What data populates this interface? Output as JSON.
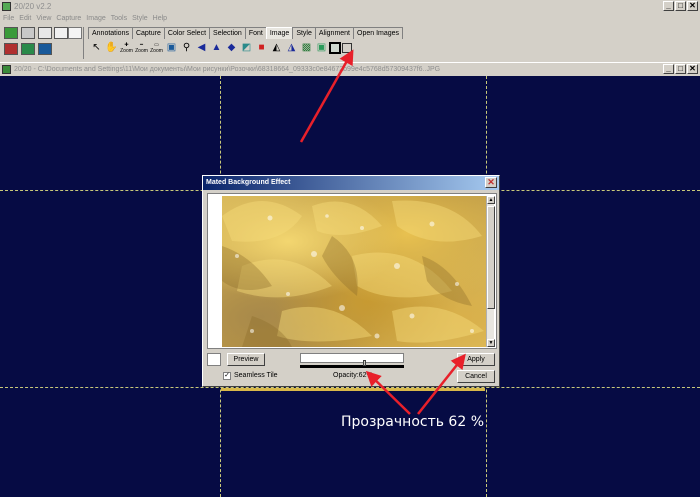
{
  "app": {
    "title": "20/20 v2.2",
    "menu": [
      "File",
      "Edit",
      "View",
      "Capture",
      "Image",
      "Tools",
      "Style",
      "Help"
    ],
    "window_buttons": [
      "_",
      "□",
      "✕"
    ]
  },
  "toolbar": {
    "tabs": [
      {
        "label": "Annotations",
        "active": false
      },
      {
        "label": "Capture",
        "active": false
      },
      {
        "label": "Color Select",
        "active": false
      },
      {
        "label": "Selection",
        "active": false
      },
      {
        "label": "Font",
        "active": false
      },
      {
        "label": "Image",
        "active": true
      },
      {
        "label": "Style",
        "active": false
      },
      {
        "label": "Alignment",
        "active": false
      },
      {
        "label": "Open Images",
        "active": false
      }
    ],
    "zoom_labels": [
      "Zoom",
      "Zoom",
      "Zoom"
    ]
  },
  "document": {
    "title": "20/20 - C:\\Documents and Settings\\11\\Мои документы\\Мои рисунки\\Розочки\\68318664_09333c0e84672b99e4c5768d57309437f6..JPG"
  },
  "dialog": {
    "title": "Mated Background Effect",
    "close": "✕",
    "preview_button": "Preview",
    "apply_button": "Apply",
    "cancel_button": "Cancel",
    "seamless_tile_label": "Seamless Tile",
    "seamless_tile_checked": true,
    "check_mark": "✓",
    "opacity_label": "Opacity:62%",
    "opacity_value": 0.62
  },
  "annotation": {
    "text": "Прозрачность 62 %",
    "color": "#ffffff",
    "arrow_color": "#e8202a"
  },
  "colors": {
    "canvas": "#060b44",
    "chrome": "#d4d0c8",
    "dialog_title": "#0a246a"
  }
}
